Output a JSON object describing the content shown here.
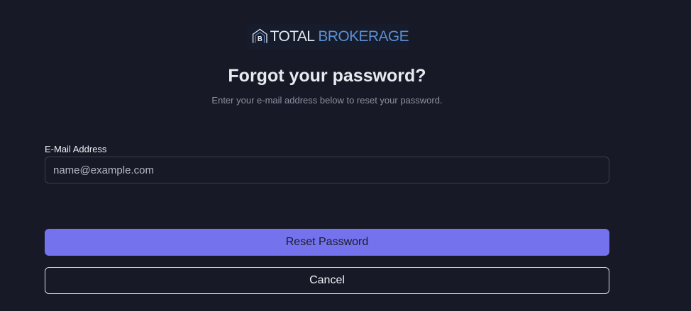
{
  "brand": {
    "name_part1": "TOTAL",
    "name_part2": "BROKERAGE",
    "mark_letter": "B",
    "accent_color": "#5b8fd3"
  },
  "page": {
    "title": "Forgot your password?",
    "subtitle": "Enter your e-mail address below to reset your password."
  },
  "form": {
    "email_label": "E-Mail Address",
    "email_value": "",
    "email_placeholder": "name@example.com",
    "submit_label": "Reset Password",
    "cancel_label": "Cancel"
  },
  "colors": {
    "background": "#171a26",
    "primary_button": "#7472ec",
    "input_border": "#3a3f4d"
  }
}
